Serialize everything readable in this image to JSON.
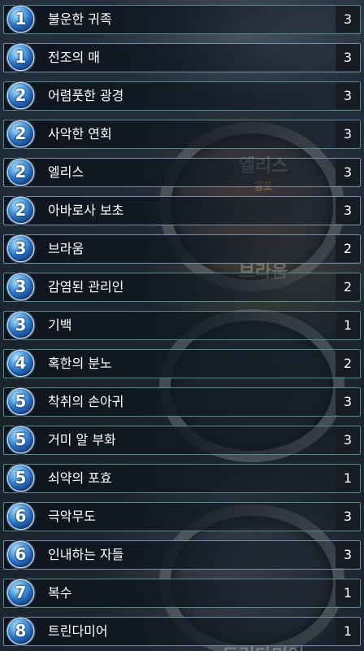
{
  "cards": [
    {
      "cost": "1",
      "name": "불운한 귀족",
      "count": "3",
      "border": "elite"
    },
    {
      "cost": "1",
      "name": "전조의 매",
      "count": "3",
      "border": "neutral"
    },
    {
      "cost": "2",
      "name": "어렴풋한 광경",
      "count": "3",
      "border": "elite"
    },
    {
      "cost": "2",
      "name": "사악한 연회",
      "count": "3",
      "border": "elite"
    },
    {
      "cost": "2",
      "name": "엘리스",
      "count": "3",
      "border": "neutral"
    },
    {
      "cost": "2",
      "name": "아바로사 보초",
      "count": "3",
      "border": "neutral"
    },
    {
      "cost": "3",
      "name": "브라움",
      "count": "2",
      "border": "neutral"
    },
    {
      "cost": "3",
      "name": "감염된 관리인",
      "count": "2",
      "border": "elite"
    },
    {
      "cost": "3",
      "name": "기백",
      "count": "1",
      "border": "elite"
    },
    {
      "cost": "4",
      "name": "혹한의 분노",
      "count": "2",
      "border": "elite"
    },
    {
      "cost": "5",
      "name": "착취의 손아귀",
      "count": "3",
      "border": "elite"
    },
    {
      "cost": "5",
      "name": "거미 알 부화",
      "count": "3",
      "border": "elite"
    },
    {
      "cost": "5",
      "name": "쇠약의 포효",
      "count": "1",
      "border": "elite"
    },
    {
      "cost": "6",
      "name": "극악무도",
      "count": "3",
      "border": "elite"
    },
    {
      "cost": "6",
      "name": "인내하는 자들",
      "count": "3",
      "border": "neutral"
    },
    {
      "cost": "7",
      "name": "복수",
      "count": "1",
      "border": "elite"
    },
    {
      "cost": "8",
      "name": "트린다미어",
      "count": "1",
      "border": "neutral"
    }
  ],
  "art": {
    "label_elise": "엘리스",
    "label_fear": "공포",
    "label_braum": "브라움",
    "label_tryndamere": "트린다미어"
  },
  "colors": {
    "border_neutral": "#7a8fa6",
    "border_elite": "#4f8f86",
    "count_bg": "#171b22",
    "gem": "#2672c4"
  }
}
